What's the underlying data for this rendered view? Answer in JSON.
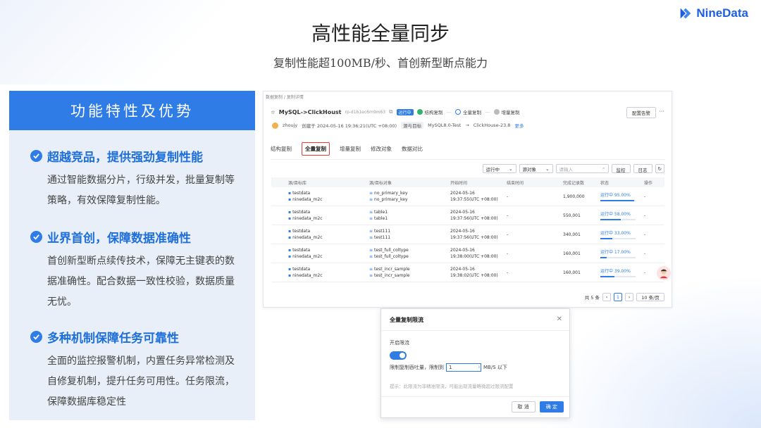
{
  "brand": {
    "name": "NineData"
  },
  "slide": {
    "title": "高性能全量同步",
    "subtitle": "复制性能超100MB/秒、首创新型断点能力"
  },
  "features_panel": {
    "heading": "功能特性及优势",
    "items": [
      {
        "title": "超越竞品，提供强劲复制性能",
        "desc": "通过智能数据分片，行级并发，批量复制等策略，有效保障复制性能。"
      },
      {
        "title": "业界首创，保障数据准确性",
        "desc": "首创新型断点续传技术，保障无主键表的数据准确性。配合数据一致性校验，数据质量无忧。"
      },
      {
        "title": "多种机制保障任务可靠性",
        "desc": "全面的监控报警机制，内置任务异常检测及自修复机制，提升任务可用性。任务限流，保障数据库稳定性"
      }
    ]
  },
  "screenshot": {
    "breadcrumb": "数据复制 / 复制详情",
    "task": {
      "name": "MySQL->ClickHoust",
      "id": "rp-d1b1ec6m9m63",
      "status": "运行中",
      "steps": [
        "结构复制",
        "全量复制",
        "增量复制"
      ],
      "config_button": "配置告警"
    },
    "meta": {
      "creator": "zhoujy",
      "created": "创建于 2024-05-16 19:36:21(UTC +08:00)",
      "source_target_label": "源与目标",
      "source": "MySQL8.0-Test",
      "target": "ClickHouse-23.8",
      "more": "更多"
    },
    "tabs": [
      "结构复制",
      "全量复制",
      "增量复制",
      "修改对象",
      "数据对比"
    ],
    "filters": {
      "status": "运行中",
      "object": "源对象",
      "search_placeholder": "请输入",
      "monitor": "监控",
      "log": "日志"
    },
    "table": {
      "headers": [
        "源/目标库",
        "源/目标对象",
        "开始时间",
        "结束时间",
        "完成记录数",
        "状态",
        "操作"
      ],
      "rows": [
        {
          "db1": "testdata",
          "db2": "ninedata_m2c",
          "obj1": "no_primary_key",
          "obj2": "no_primary_key",
          "t1": "2024-05-16",
          "t2": "19:37:55(UTC +08:00)",
          "end": "-",
          "count": "1,900,000",
          "status": "运行中 95.00%",
          "progress": 0.95,
          "op": "-"
        },
        {
          "db1": "testdata",
          "db2": "ninedata_m2c",
          "obj1": "table1",
          "obj2": "table1",
          "t1": "2024-05-16",
          "t2": "19:37:56(UTC +08:00)",
          "end": "-",
          "count": "550,001",
          "status": "运行中 58.00%",
          "progress": 0.58,
          "op": "-"
        },
        {
          "db1": "testdata",
          "db2": "ninedata_m2c",
          "obj1": "test111",
          "obj2": "test111",
          "t1": "2024-05-16",
          "t2": "19:37:56(UTC +08:00)",
          "end": "-",
          "count": "340,001",
          "status": "运行中 33.00%",
          "progress": 0.33,
          "op": "-"
        },
        {
          "db1": "testdata",
          "db2": "ninedata_m2c",
          "obj1": "test_full_coltype",
          "obj2": "test_full_coltype",
          "t1": "2024-05-16",
          "t2": "19:38:00(UTC +08:00)",
          "end": "-",
          "count": "160,001",
          "status": "运行中 17.00%",
          "progress": 0.17,
          "op": "-"
        },
        {
          "db1": "testdata",
          "db2": "ninedata_m2c",
          "obj1": "test_incr_sample",
          "obj2": "test_incr_sample",
          "t1": "2024-05-16",
          "t2": "19:38:02(UTC +08:00)",
          "end": "-",
          "count": "160,001",
          "status": "运行中 39.00%",
          "progress": 0.39,
          "op": "-"
        }
      ]
    },
    "pager": {
      "total": "共 5 条",
      "current": "1",
      "page_size": "10 条/页"
    }
  },
  "dialog": {
    "title": "全量复制限流",
    "enable_label": "开启限流",
    "limit_prefix": "限制复制吞吐量，限制到",
    "limit_value": "1",
    "limit_unit": "MB/S 以下",
    "tip": "提示：此限流为非精准限流，可能出现流量略微超过限流配置",
    "cancel": "取 消",
    "confirm": "确 定"
  },
  "colors": {
    "accent": "#2f7ce6",
    "panel_bg": "#e9eff8",
    "highlight": "#e53935"
  }
}
